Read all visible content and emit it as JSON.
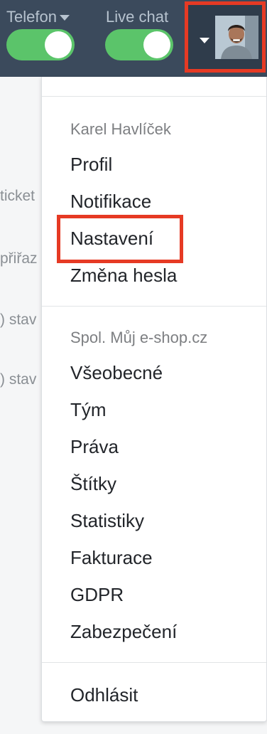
{
  "topbar": {
    "telefon_label": "Telefon",
    "livechat_label": "Live chat",
    "telefon_on": true,
    "livechat_on": true
  },
  "background": {
    "lines": [
      "ticket",
      "přiřaz",
      ") stav",
      ") stav"
    ]
  },
  "menu": {
    "user_name": "Karel Havlíček",
    "user_items": [
      "Profil",
      "Notifikace",
      "Nastavení",
      "Změna hesla"
    ],
    "company_name": "Spol. Můj e-shop.cz",
    "company_items": [
      "Všeobecné",
      "Tým",
      "Práva",
      "Štítky",
      "Statistiky",
      "Fakturace",
      "GDPR",
      "Zabezpečení"
    ],
    "logout": "Odhlásit"
  },
  "colors": {
    "topbar": "#3b4a5c",
    "toggle_on": "#5bc46a",
    "highlight": "#e63a24"
  }
}
